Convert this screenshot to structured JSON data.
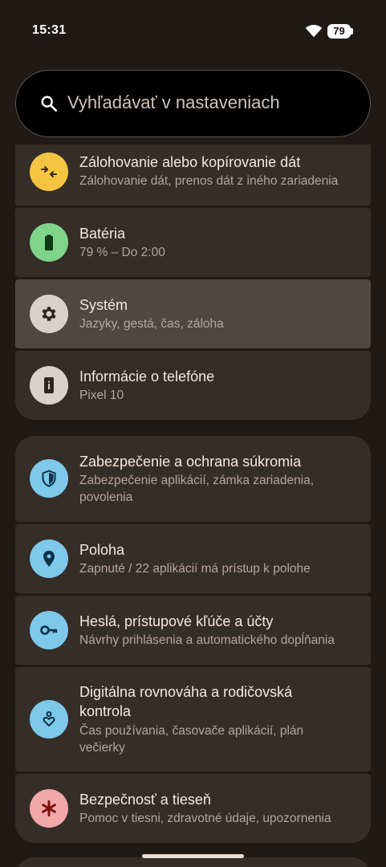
{
  "status_bar": {
    "time": "15:31",
    "battery_level": "79",
    "wifi_icon": "wifi-icon",
    "battery_icon": "battery-icon"
  },
  "search": {
    "placeholder": "Vyhľadávať v nastaveniach",
    "icon": "search-icon"
  },
  "group1": {
    "items": [
      {
        "title": "Zálohovanie alebo kopírovanie dát",
        "subtitle": "Zálohovanie dát, prenos dát z iného zariadenia",
        "icon": "data-transfer-icon",
        "icon_color": "#f4c542"
      },
      {
        "title": "Batéria",
        "subtitle": "79 % – Do 2:00",
        "icon": "battery-icon",
        "icon_color": "#7fd48a"
      },
      {
        "title": "Systém",
        "subtitle": "Jazyky, gestá, čas, záloha",
        "icon": "gear-icon",
        "icon_color": "#d9d1cc",
        "highlighted": true
      },
      {
        "title": "Informácie o telefóne",
        "subtitle": "Pixel 10",
        "icon": "phone-info-icon",
        "icon_color": "#d9d1cc"
      }
    ]
  },
  "group2": {
    "items": [
      {
        "title": "Zabezpečenie a ochrana súkromia",
        "subtitle": "Zabezpečenie aplikácií, zámka zariadenia, povolenia",
        "icon": "shield-icon",
        "icon_color": "#7ec8ea"
      },
      {
        "title": "Poloha",
        "subtitle": "Zapnuté / 22 aplikácií má prístup k polohe",
        "icon": "location-pin-icon",
        "icon_color": "#7ec8ea"
      },
      {
        "title": "Heslá, prístupové kľúče a účty",
        "subtitle": "Návrhy prihlásenia a automatického dopĺňania",
        "icon": "key-icon",
        "icon_color": "#7ec8ea"
      },
      {
        "title": "Digitálna rovnováha a rodičovská kontrola",
        "subtitle": "Čas používania, časovače aplikácií, plán večierky",
        "icon": "wellbeing-icon",
        "icon_color": "#7ec8ea"
      },
      {
        "title": "Bezpečnosť a tieseň",
        "subtitle": "Pomoc v tiesni, zdravotné údaje, upozornenia",
        "icon": "emergency-asterisk-icon",
        "icon_color": "#f2a8a8"
      }
    ]
  }
}
